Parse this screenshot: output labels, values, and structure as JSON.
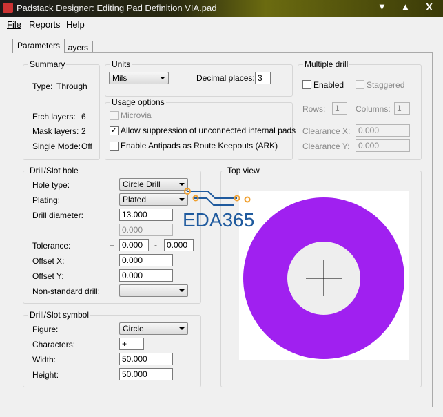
{
  "window": {
    "title": "Padstack Designer: Editing Pad Definition VIA.pad"
  },
  "menu": [
    "File",
    "Reports",
    "Help"
  ],
  "tabs": [
    "Parameters",
    "Layers"
  ],
  "summary": {
    "title": "Summary",
    "type_label": "Type:",
    "type_value": "Through",
    "etch_label": "Etch layers:",
    "etch_value": "6",
    "mask_label": "Mask layers:",
    "mask_value": "2",
    "single_label": "Single Mode:",
    "single_value": "Off"
  },
  "units": {
    "title": "Units",
    "unit_value": "Mils",
    "decimal_label": "Decimal places:",
    "decimal_value": "3"
  },
  "usage": {
    "title": "Usage options",
    "microvia": "Microvia",
    "allow": "Allow suppression of unconnected internal pads",
    "allow_checked": true,
    "ark": "Enable Antipads as Route Keepouts (ARK)"
  },
  "multi": {
    "title": "Multiple drill",
    "enabled": "Enabled",
    "staggered": "Staggered",
    "rows_label": "Rows:",
    "rows_value": "1",
    "cols_label": "Columns:",
    "cols_value": "1",
    "clx_label": "Clearance X:",
    "clx_value": "0.000",
    "cly_label": "Clearance Y:",
    "cly_value": "0.000"
  },
  "hole": {
    "title": "Drill/Slot hole",
    "type_label": "Hole type:",
    "type_value": "Circle Drill",
    "plating_label": "Plating:",
    "plating_value": "Plated",
    "diam_label": "Drill diameter:",
    "diam_value": "13.000",
    "diam2_value": "0.000",
    "tol_label": "Tolerance:",
    "plus": "+",
    "tol_plus": "0.000",
    "minus": "-",
    "tol_minus": "0.000",
    "offx_label": "Offset X:",
    "offx_value": "0.000",
    "offy_label": "Offset Y:",
    "offy_value": "0.000",
    "nonstd_label": "Non-standard drill:",
    "nonstd_value": ""
  },
  "symbol": {
    "title": "Drill/Slot symbol",
    "figure_label": "Figure:",
    "figure_value": "Circle",
    "chars_label": "Characters:",
    "chars_value": "+",
    "width_label": "Width:",
    "width_value": "50.000",
    "height_label": "Height:",
    "height_value": "50.000"
  },
  "topview": {
    "title": "Top view",
    "pad_color": "#a020f0"
  },
  "watermark": "EDA365"
}
